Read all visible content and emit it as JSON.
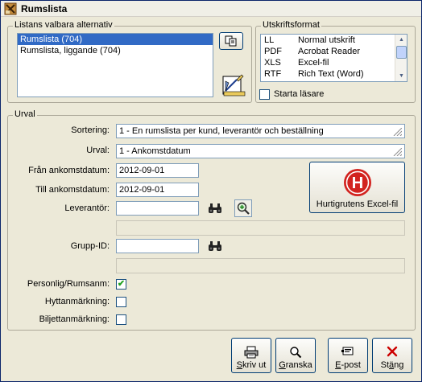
{
  "window": {
    "title": "Rumslista"
  },
  "lists_group": {
    "legend": "Listans valbara alternativ",
    "items": [
      {
        "label": "Rumslista (704)",
        "selected": true
      },
      {
        "label": "Rumslista, liggande (704)",
        "selected": false
      }
    ]
  },
  "format_group": {
    "legend": "Utskriftsformat",
    "formats": [
      {
        "code": "LL",
        "desc": "Normal utskrift"
      },
      {
        "code": "PDF",
        "desc": "Acrobat Reader"
      },
      {
        "code": "XLS",
        "desc": "Excel-fil"
      },
      {
        "code": "RTF",
        "desc": "Rich Text (Word)"
      }
    ],
    "start_reader_label": "Starta läsare",
    "start_reader_checked": false
  },
  "selection": {
    "legend": "Urval",
    "sort_label": "Sortering:",
    "sort_value": "1  - En rumslista per kund, leverantör och beställning",
    "filter_label": "Urval:",
    "filter_value": "1  - Ankomstdatum",
    "from_label": "Från ankomstdatum:",
    "from_value": "2012-09-01",
    "to_label": "Till ankomstdatum:",
    "to_value": "2012-09-01",
    "supplier_label": "Leverantör:",
    "supplier_value": "",
    "supplier_name": "",
    "group_label": "Grupp-ID:",
    "group_value": "",
    "group_name": "",
    "excel_button_label": "Hurtigrutens Excel-fil",
    "excel_logo_letter": "H",
    "personal_label": "Personlig/Rumsanm:",
    "personal_checked": true,
    "cabin_label": "Hyttanmärkning:",
    "cabin_checked": false,
    "ticket_label": "Biljettanmärkning:",
    "ticket_checked": false,
    "check_mark": "✔"
  },
  "actions": {
    "print": {
      "label": "Skriv ut",
      "underline": "S",
      "rest": "kriv ut"
    },
    "preview": {
      "label": "Granska",
      "underline": "G",
      "rest": "ranska"
    },
    "email": {
      "label": "E-post",
      "underline": "E",
      "rest": "-post"
    },
    "close": {
      "label": "Stäng",
      "underline": "ä",
      "pre": "St",
      "rest": "ng"
    }
  },
  "colors": {
    "selection": "#316ac5",
    "close_icon": "#cc0000",
    "logo_red": "#d2231f"
  }
}
